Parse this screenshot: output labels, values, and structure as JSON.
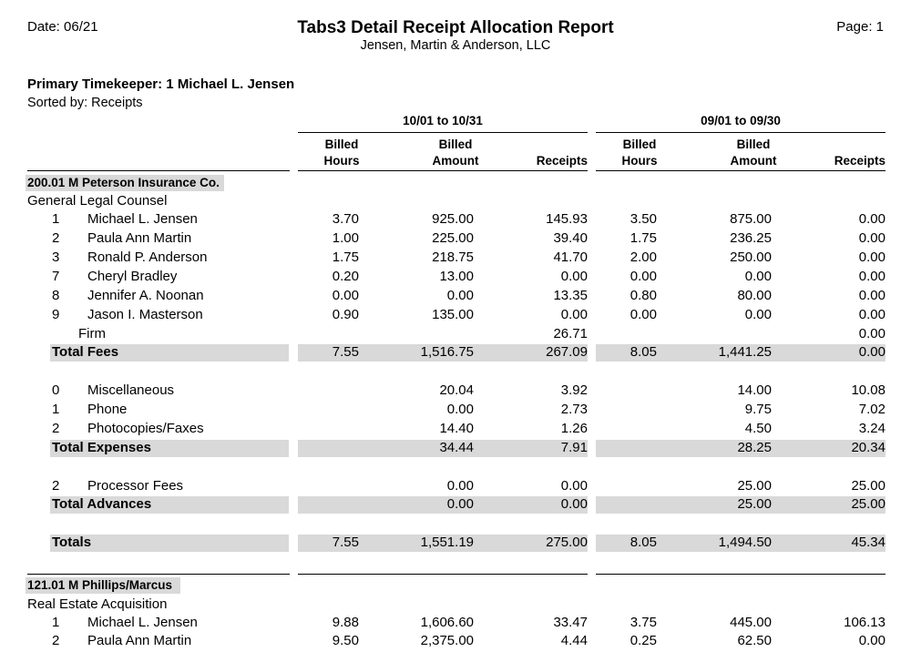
{
  "header": {
    "date": "Date: 06/21",
    "title": "Tabs3 Detail Receipt Allocation Report",
    "firm": "Jensen, Martin & Anderson, LLC",
    "page": "Page: 1"
  },
  "timekeeper": "Primary Timekeeper: 1 Michael L. Jensen",
  "sorted_by": "Sorted by: Receipts",
  "periods": [
    "10/01 to 10/31",
    "09/01 to 09/30"
  ],
  "columns": {
    "billed": "Billed",
    "hours": "Hours",
    "amount": "Amount",
    "receipts": "Receipts"
  },
  "clients": [
    {
      "name": "200.01 M Peterson Insurance Co.",
      "matter": "General Legal Counsel"
    },
    {
      "name": "121.01 M Phillips/Marcus",
      "matter": "Real Estate Acquisition"
    }
  ],
  "rows": [
    {
      "num": "1",
      "name": "Michael L. Jensen",
      "v": [
        "3.70",
        "925.00",
        "145.93",
        "3.50",
        "875.00",
        "0.00"
      ]
    },
    {
      "num": "2",
      "name": "Paula Ann Martin",
      "v": [
        "1.00",
        "225.00",
        "39.40",
        "1.75",
        "236.25",
        "0.00"
      ]
    },
    {
      "num": "3",
      "name": "Ronald P. Anderson",
      "v": [
        "1.75",
        "218.75",
        "41.70",
        "2.00",
        "250.00",
        "0.00"
      ]
    },
    {
      "num": "7",
      "name": "Cheryl Bradley",
      "v": [
        "0.20",
        "13.00",
        "0.00",
        "0.00",
        "0.00",
        "0.00"
      ]
    },
    {
      "num": "8",
      "name": "Jennifer A. Noonan",
      "v": [
        "0.00",
        "0.00",
        "13.35",
        "0.80",
        "80.00",
        "0.00"
      ]
    },
    {
      "num": "9",
      "name": "Jason I. Masterson",
      "v": [
        "0.90",
        "135.00",
        "0.00",
        "0.00",
        "0.00",
        "0.00"
      ]
    },
    {
      "num": "",
      "name": "Firm",
      "v": [
        "",
        "",
        "26.71",
        "",
        "",
        "0.00"
      ]
    },
    {
      "num": "",
      "name": "Total Fees",
      "total": true,
      "v": [
        "7.55",
        "1,516.75",
        "267.09",
        "8.05",
        "1,441.25",
        "0.00"
      ]
    },
    {
      "num": "0",
      "name": "Miscellaneous",
      "v": [
        "",
        "20.04",
        "3.92",
        "",
        "14.00",
        "10.08"
      ]
    },
    {
      "num": "1",
      "name": "Phone",
      "v": [
        "",
        "0.00",
        "2.73",
        "",
        "9.75",
        "7.02"
      ]
    },
    {
      "num": "2",
      "name": "Photocopies/Faxes",
      "v": [
        "",
        "14.40",
        "1.26",
        "",
        "4.50",
        "3.24"
      ]
    },
    {
      "num": "",
      "name": "Total Expenses",
      "total": true,
      "v": [
        "",
        "34.44",
        "7.91",
        "",
        "28.25",
        "20.34"
      ]
    },
    {
      "num": "2",
      "name": "Processor Fees",
      "v": [
        "",
        "0.00",
        "0.00",
        "",
        "25.00",
        "25.00"
      ]
    },
    {
      "num": "",
      "name": "Total Advances",
      "total": true,
      "v": [
        "",
        "0.00",
        "0.00",
        "",
        "25.00",
        "25.00"
      ]
    },
    {
      "num": "",
      "name": "Totals",
      "total": true,
      "v": [
        "7.55",
        "1,551.19",
        "275.00",
        "8.05",
        "1,494.50",
        "45.34"
      ]
    },
    {
      "num": "1",
      "name": "Michael L. Jensen",
      "v": [
        "9.88",
        "1,606.60",
        "33.47",
        "3.75",
        "445.00",
        "106.13"
      ]
    },
    {
      "num": "2",
      "name": "Paula Ann Martin",
      "v": [
        "9.50",
        "2,375.00",
        "4.44",
        "0.25",
        "62.50",
        "0.00"
      ]
    }
  ]
}
